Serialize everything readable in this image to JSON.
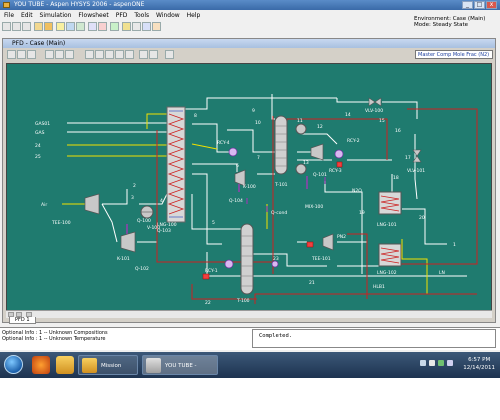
{
  "window": {
    "title": "YOU TUBE - Aspen HYSYS 2006 - aspenONE",
    "min": "_",
    "max": "□",
    "close": "x"
  },
  "menu": [
    "File",
    "Edit",
    "Simulation",
    "Flowsheet",
    "PFD",
    "Tools",
    "Window",
    "Help"
  ],
  "environment": {
    "env": "Environment: Case (Main)",
    "mode": "Mode: Steady State"
  },
  "pfd_window": {
    "title": "PFD - Case (Main)",
    "component_selector": "Master Comp Mole Frac (N2)",
    "tab": "PFD 1"
  },
  "labels": {
    "gas01": "GAS01",
    "gas": "GAS",
    "s24": "24",
    "s25": "25",
    "air": "Air",
    "tee100": "TEE-100",
    "lng100": "LNG-100",
    "q103": "Q-103",
    "s2": "2",
    "s3": "3",
    "s4": "4",
    "s8": "8",
    "v100": "V-100",
    "q100": "Q-100",
    "k101": "K-101",
    "q102": "Q-102",
    "rcy4": "RCY-4",
    "s9": "9",
    "s10": "10",
    "s7": "7",
    "s6": "6",
    "q104": "Q-104",
    "k100": "K-100",
    "s11": "11",
    "s12": "12",
    "t101": "T-101",
    "qcond": "Q-cond",
    "q101": "Q-101",
    "s13": "13",
    "mix100": "MIX-100",
    "rcy3": "RCY-3",
    "rcy2": "RCY-2",
    "s14": "14",
    "s15": "15",
    "s16": "16",
    "vlv100": "VLV-100",
    "vlv101": "VLV-101",
    "s17": "17",
    "s18": "18",
    "s19": "19",
    "s20": "20",
    "n2o": "N2O",
    "lng101": "LNG-101",
    "lng102": "LNG-102",
    "s1": "1",
    "s21": "21",
    "ln": "LN",
    "hlb1": "HLB1",
    "rcy1": "RCY-1",
    "s22": "22",
    "s23": "23",
    "t100": "T-100",
    "tee101": "TEE-101",
    "pn2": "PN2",
    "s5": "5"
  },
  "status": {
    "line1": "Optional Info : 1 -- Unknown Compositions",
    "line2": "Optional Info : 1 -- Unknown Temperature",
    "message": "Completed."
  },
  "taskbar": {
    "tasks": [
      "Mission 1000",
      "YOU TUBE - Aspe..."
    ],
    "time": "6:57 PM",
    "date": "12/14/2011"
  }
}
